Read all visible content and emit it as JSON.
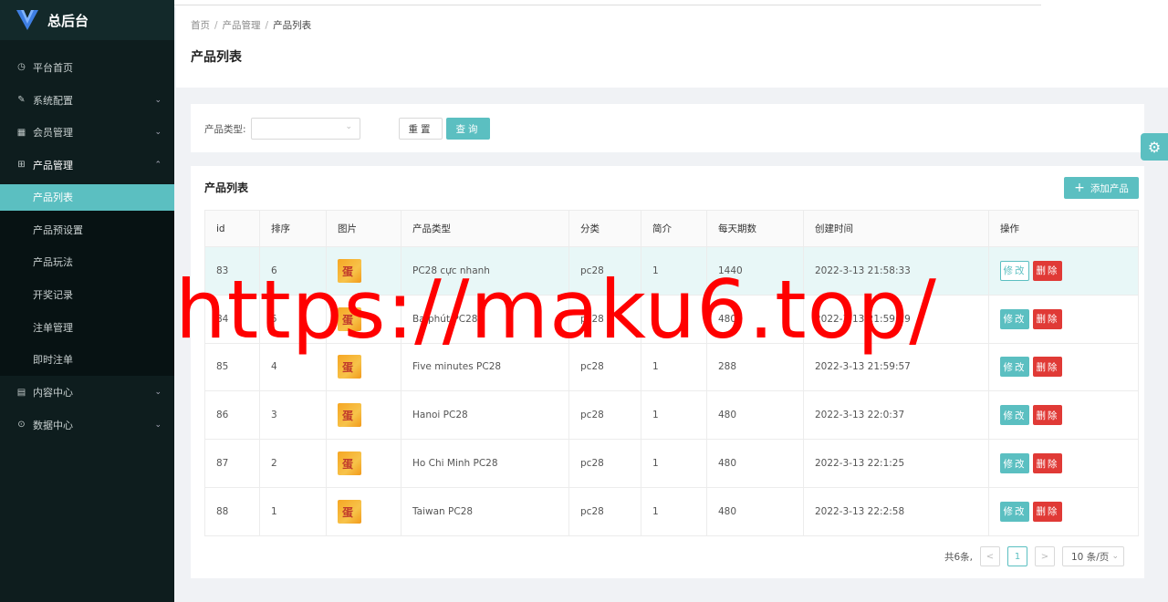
{
  "app": {
    "title": "总后台"
  },
  "sidebar": {
    "items": [
      {
        "label": "平台首页",
        "icon": "dashboard-icon",
        "arrow": ""
      },
      {
        "label": "系统配置",
        "icon": "edit-icon",
        "arrow": "⌄"
      },
      {
        "label": "会员管理",
        "icon": "table-icon",
        "arrow": "⌄"
      },
      {
        "label": "产品管理",
        "icon": "grid-icon",
        "arrow": "⌃"
      },
      {
        "label": "内容中心",
        "icon": "document-icon",
        "arrow": "⌄"
      },
      {
        "label": "数据中心",
        "icon": "check-circle-icon",
        "arrow": "⌄"
      }
    ],
    "sub_items": [
      "产品列表",
      "产品预设置",
      "产品玩法",
      "开奖记录",
      "注单管理",
      "即时注单"
    ]
  },
  "breadcrumb": [
    "首页",
    "产品管理",
    "产品列表"
  ],
  "page_title": "产品列表",
  "filter": {
    "label": "产品类型:",
    "select_value": "",
    "reset_label": "重置",
    "query_label": "查询"
  },
  "list": {
    "title": "产品列表",
    "add_label": "添加产品",
    "columns": [
      "id",
      "排序",
      "图片",
      "产品类型",
      "分类",
      "简介",
      "每天期数",
      "创建时间",
      "操作"
    ],
    "rows": [
      {
        "id": "83",
        "sort": "6",
        "type": "PC28 cực nhanh",
        "category": "pc28",
        "intro": "1",
        "daily": "1440",
        "created": "2022-3-13 21:58:33"
      },
      {
        "id": "84",
        "sort": "5",
        "type": "Ba phút PC28",
        "category": "pc28",
        "intro": "1",
        "daily": "480",
        "created": "2022-3-13 21:59:29"
      },
      {
        "id": "85",
        "sort": "4",
        "type": "Five minutes PC28",
        "category": "pc28",
        "intro": "1",
        "daily": "288",
        "created": "2022-3-13 21:59:57"
      },
      {
        "id": "86",
        "sort": "3",
        "type": "Hanoi PC28",
        "category": "pc28",
        "intro": "1",
        "daily": "480",
        "created": "2022-3-13 22:0:37"
      },
      {
        "id": "87",
        "sort": "2",
        "type": "Ho Chi Minh PC28",
        "category": "pc28",
        "intro": "1",
        "daily": "480",
        "created": "2022-3-13 22:1:25"
      },
      {
        "id": "88",
        "sort": "1",
        "type": "Taiwan PC28",
        "category": "pc28",
        "intro": "1",
        "daily": "480",
        "created": "2022-3-13 22:2:58"
      }
    ],
    "edit_label": "修改",
    "delete_label": "删除",
    "thumb_text": "蛋"
  },
  "pager": {
    "total": "共6条,",
    "prev": "<",
    "current": "1",
    "next": ">",
    "page_size": "10 条/页"
  },
  "watermark": "https://maku6.top/",
  "colors": {
    "accent": "#5bbfc1",
    "danger": "#e03a36",
    "sidebar_bg": "#0e1d1e",
    "watermark": "#ff0000"
  }
}
